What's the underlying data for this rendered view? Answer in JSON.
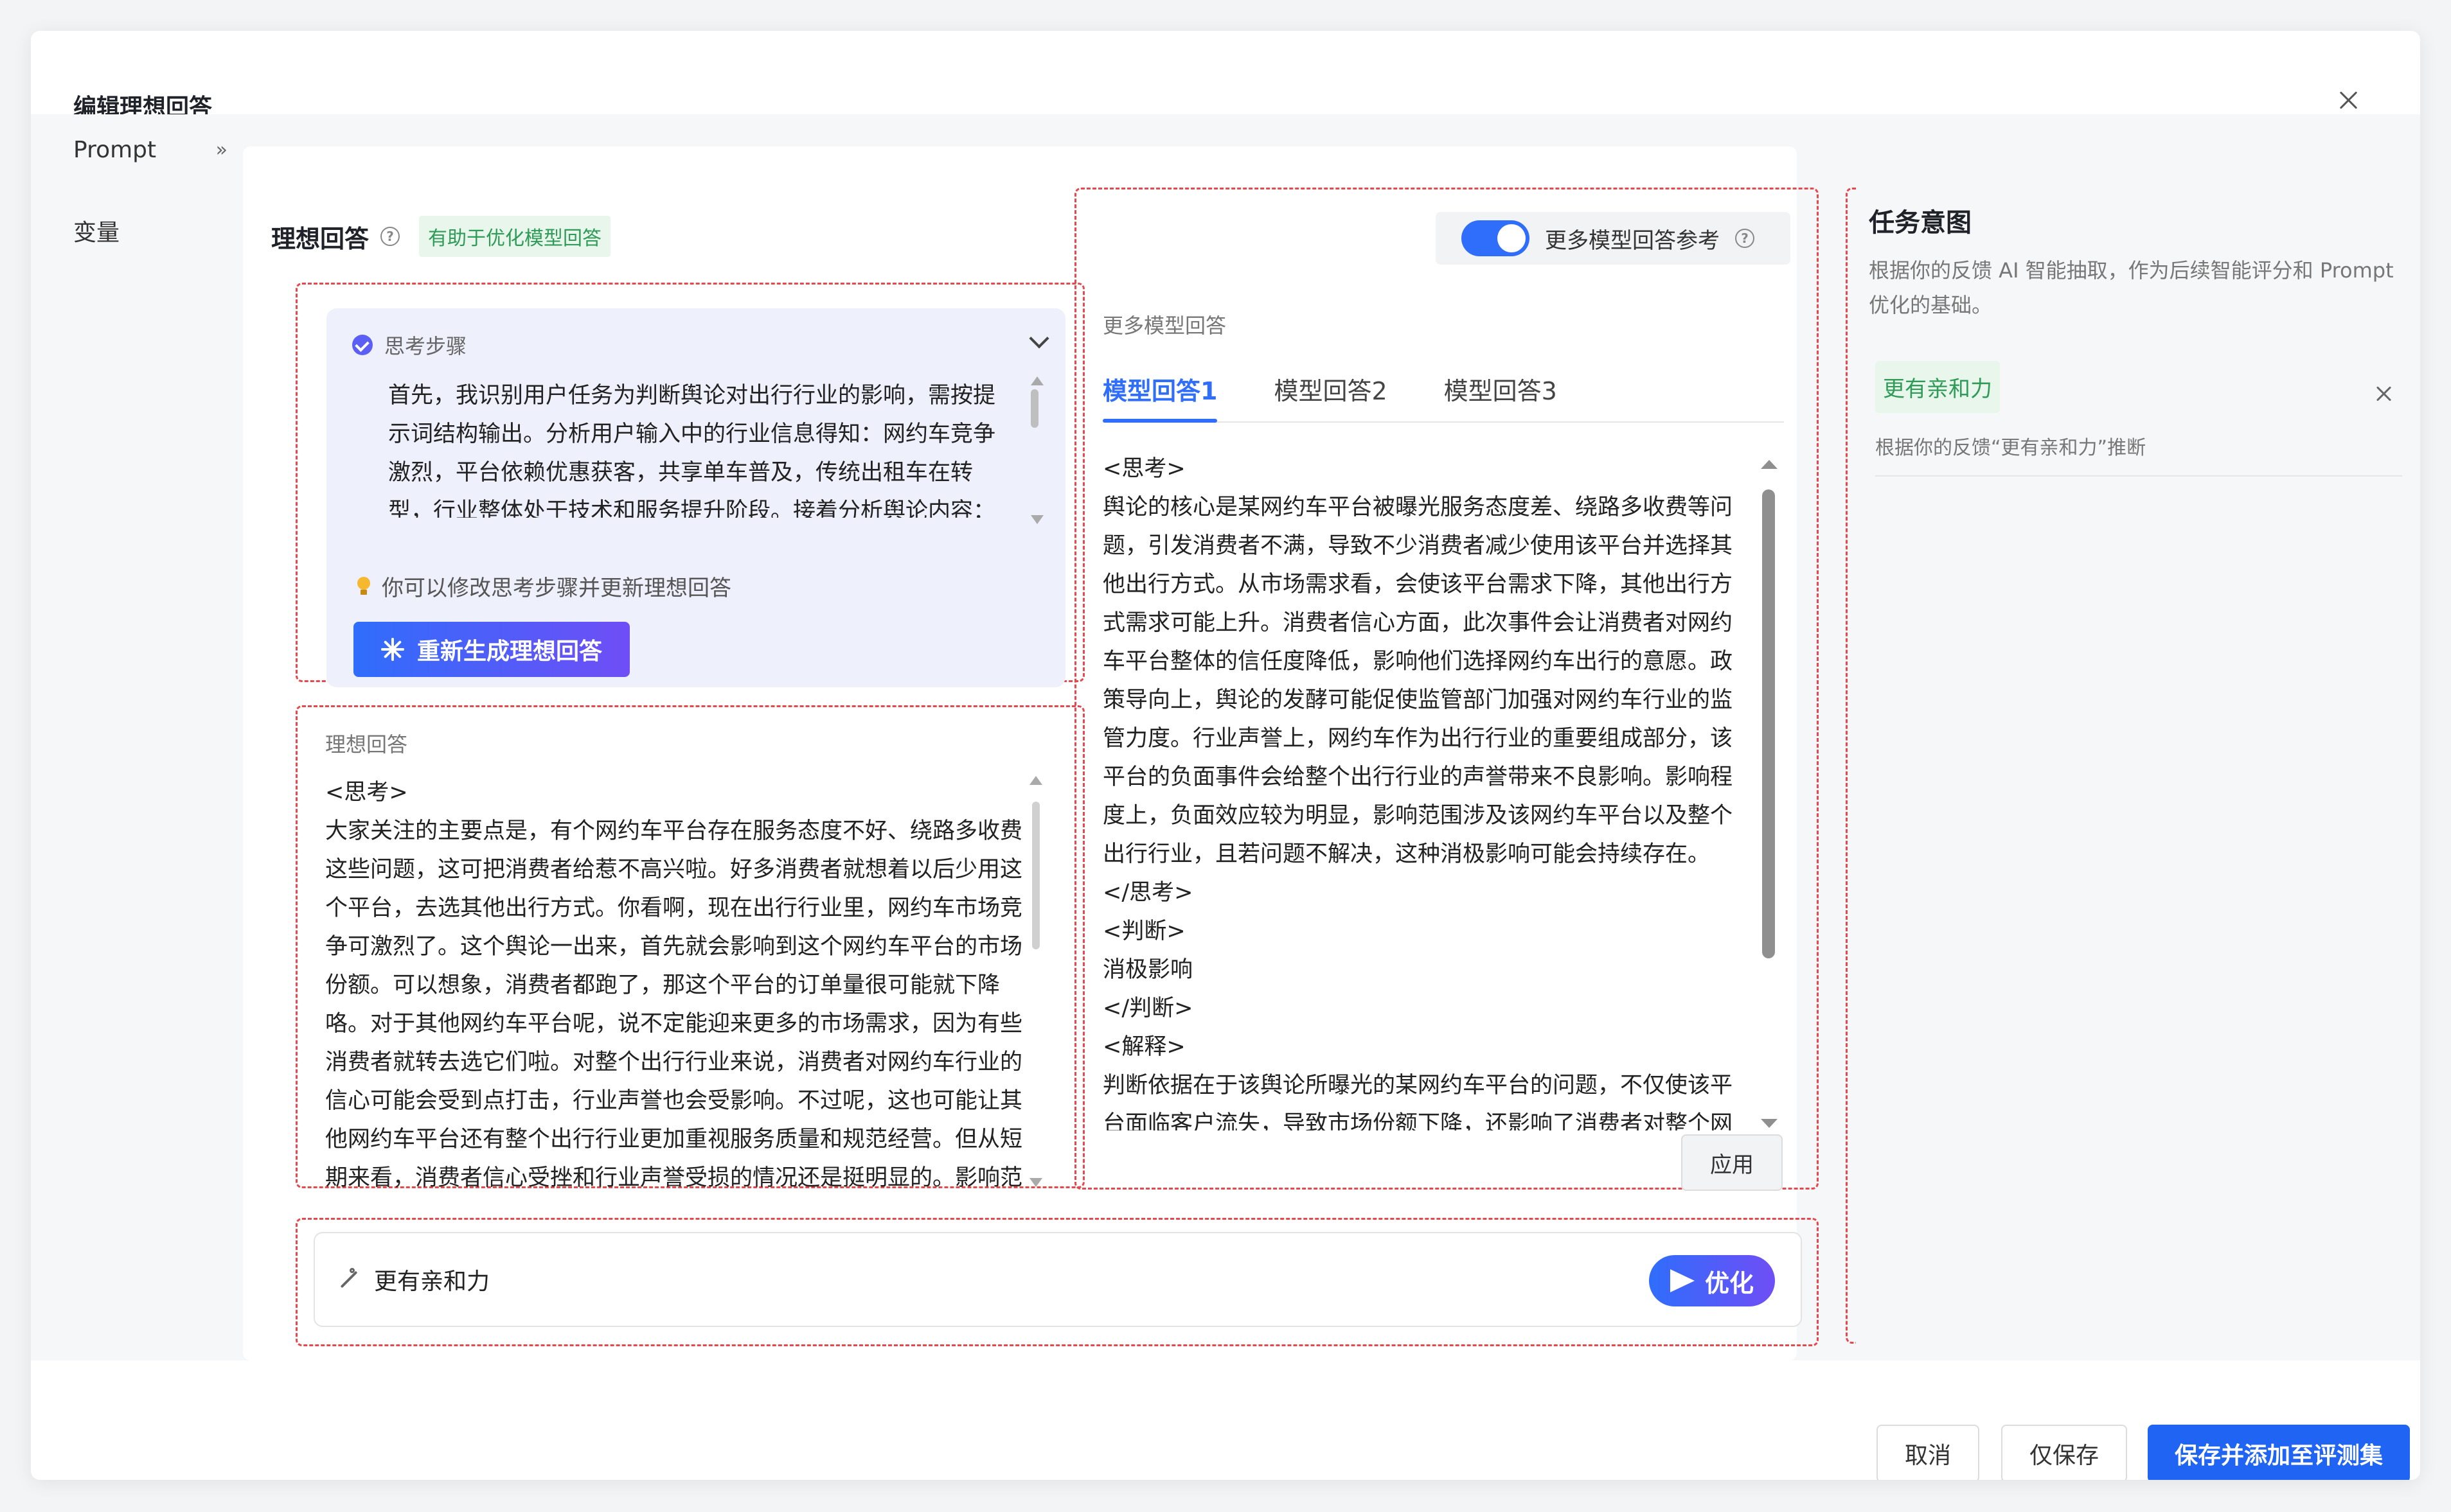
{
  "modal": {
    "title": "编辑理想回答"
  },
  "sidebar": {
    "items": [
      {
        "label": "Prompt",
        "chevron": "»"
      },
      {
        "label": "变量"
      }
    ]
  },
  "ideal": {
    "title": "理想回答",
    "tag": "有助于优化模型回答",
    "steps_title": "思考步骤",
    "steps_text": "首先，我识别用户任务为判断舆论对出行行业的影响，需按提示词结构输出。分析用户输入中的行业信息得知：网约车竞争激烈，平台依赖优惠获客，共享单车普及，传统出租车在转型，行业整体处于技术和服务提升阶段。接着分析舆论内容：某网约车平台因服务差、绕路收费引发消费者不满",
    "tip": "你可以修改思考步骤并更新理想回答",
    "regen_button": "重新生成理想回答",
    "answer_label": "理想回答",
    "answer_lines": [
      "<思考>",
      "大家关注的主要点是，有个网约车平台存在服务态度不好、绕路多收费这些问题，这可把消费者给惹不高兴啦。好多消费者就想着以后少用这个平台，去选其他出行方式。你看啊，现在出行行业里，网约车市场竞争可激烈了。这个舆论一出来，首先就会影响到这个网约车平台的市场份额。可以想象，消费者都跑了，那这个平台的订单量很可能就下降咯。对于其他网约车平台呢，说不定能迎来更多的市场需求，因为有些消费者就转去选它们啦。对整个出行行业来说，消费者对网约车行业的信心可能会受到点打击，行业声誉也会受影响。不过呢，这也可能让其他网约车平台还有整个出行行业更加重视服务质量和规范经营。但从短期来看，消费者信心受挫和行业声誉受损的情况还是挺明显的。影响范"
    ]
  },
  "more_models": {
    "toggle_label": "更多模型回答参考",
    "toggle_on": true,
    "section_label": "更多模型回答",
    "tabs": [
      "模型回答1",
      "模型回答2",
      "模型回答3"
    ],
    "active_tab": 0,
    "lines": [
      "<思考>",
      "舆论的核心是某网约车平台被曝光服务态度差、绕路多收费等问题，引发消费者不满，导致不少消费者减少使用该平台并选择其他出行方式。从市场需求看，会使该平台需求下降，其他出行方式需求可能上升。消费者信心方面，此次事件会让消费者对网约车平台整体的信任度降低，影响他们选择网约车出行的意愿。政策导向上，舆论的发酵可能促使监管部门加强对网约车行业的监管力度。行业声誉上，网约车作为出行行业的重要组成部分，该平台的负面事件会给整个出行行业的声誉带来不良影响。影响程度上，负面效应较为明显，影响范围涉及该网约车平台以及整个出行行业，且若问题不解决，这种消极影响可能会持续存在。",
      "</思考>",
      "<判断>",
      "消极影响",
      "</判断>",
      "<解释>",
      "判断依据在于该舆论所曝光的某网约车平台的问题，不仅使该平台面临客户流失，导致市场份额下降，还影响了消费者对整个网"
    ],
    "apply_button": "应用"
  },
  "optimize": {
    "value": "更有亲和力",
    "button": "优化"
  },
  "intent": {
    "title": "任务意图",
    "desc": "根据你的反馈 AI 智能抽取，作为后续智能评分和 Prompt 优化的基础。",
    "items": [
      {
        "tag": "更有亲和力",
        "sub": "根据你的反馈“更有亲和力”推断"
      }
    ]
  },
  "footer": {
    "cancel": "取消",
    "save_only": "仅保存",
    "save_add": "保存并添加至评测集"
  },
  "colors": {
    "primary": "#1f64f2",
    "accent_gradient_end": "#6f4ef6",
    "tag_green": "#2e9b57",
    "dashed_red": "#e5484d"
  },
  "icons": [
    "close-icon",
    "help-icon",
    "check-circle-icon",
    "chevron-down-icon",
    "bulb-icon",
    "sparkle-icon",
    "wand-icon",
    "send-icon"
  ]
}
